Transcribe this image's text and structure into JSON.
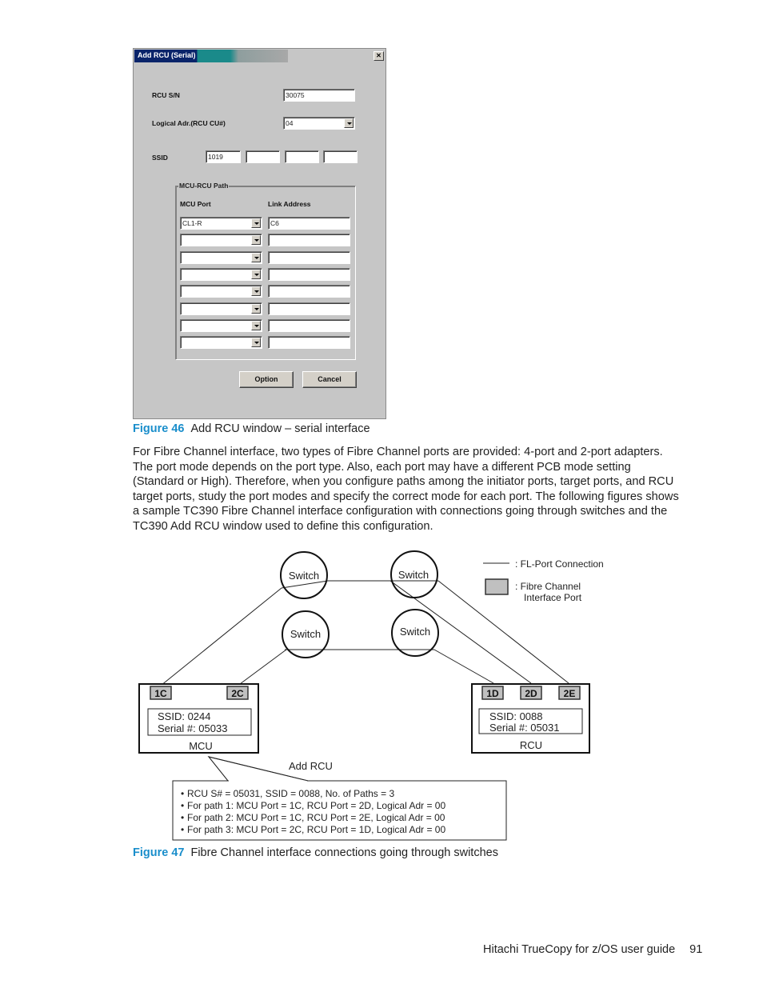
{
  "dialog": {
    "title": "Add RCU (Serial)",
    "close_glyph": "✕",
    "rcu_sn": {
      "label": "RCU S/N",
      "value": "30075"
    },
    "logical_adr": {
      "label": "Logical Adr.(RCU CU#)",
      "value": "04"
    },
    "ssid": {
      "label": "SSID",
      "values": [
        "1019",
        "",
        "",
        ""
      ]
    },
    "path_group": {
      "legend": "MCU-RCU Path",
      "col_port": "MCU Port",
      "col_link": "Link Address",
      "rows": [
        {
          "port": "CL1-R",
          "link": "C6"
        },
        {
          "port": "",
          "link": ""
        },
        {
          "port": "",
          "link": ""
        },
        {
          "port": "",
          "link": ""
        },
        {
          "port": "",
          "link": ""
        },
        {
          "port": "",
          "link": ""
        },
        {
          "port": "",
          "link": ""
        },
        {
          "port": "",
          "link": ""
        }
      ]
    },
    "buttons": {
      "option": "Option",
      "cancel": "Cancel"
    }
  },
  "figure46": {
    "label": "Figure 46",
    "caption": "Add RCU window – serial interface"
  },
  "paragraph": [
    "For Fibre Channel interface, two types of Fibre Channel ports are provided: 4-port and 2-port adapters.",
    "The port mode depends on the port type. Also, each port may have a different PCB mode setting",
    "(Standard or High). Therefore, when you configure paths among the initiator ports, target ports, and RCU",
    "target ports, study the port modes and specify the correct mode for each port. The following figures shows",
    "a sample TC390 Fibre Channel interface configuration with connections going through switches and the",
    "TC390 Add RCU window used to define this configuration."
  ],
  "diagram": {
    "switch_label": "Switch",
    "legend": {
      "line": ": FL-Port Connection",
      "port_line1": ": Fibre Channel",
      "port_line2": "Interface Port"
    },
    "mcu": {
      "name": "MCU",
      "ssid": "SSID: 0244",
      "serial": "Serial #: 05033",
      "ports": [
        "1C",
        "2C"
      ]
    },
    "rcu": {
      "name": "RCU",
      "ssid": "SSID: 0088",
      "serial": "Serial #: 05031",
      "ports": [
        "1D",
        "2D",
        "2E"
      ]
    },
    "callout_title": "Add RCU",
    "callout_lines": [
      "RCU S# = 05031, SSID = 0088, No. of Paths = 3",
      "For path 1: MCU Port = 1C, RCU Port = 2D, Logical Adr = 00",
      "For path 2: MCU Port = 1C, RCU Port = 2E, Logical Adr = 00",
      "For path 3: MCU Port = 2C, RCU Port = 1D, Logical Adr = 00"
    ],
    "bullet": "•",
    "colors": {
      "port_fill": "#c0c0c0",
      "line": "#222222"
    }
  },
  "figure47": {
    "label": "Figure 47",
    "caption": "Fibre Channel interface connections going through switches"
  },
  "footer": {
    "title": "Hitachi TrueCopy for z/OS user guide",
    "page": "91"
  }
}
